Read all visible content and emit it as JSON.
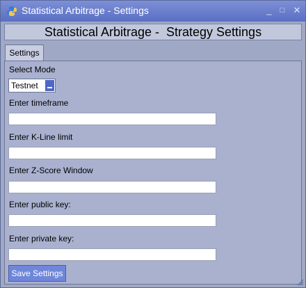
{
  "window": {
    "title": "Statistical Arbitrage - Settings",
    "minimize_glyph": "_",
    "maximize_glyph": "□",
    "close_glyph": "✕"
  },
  "header": {
    "title": "Statistical Arbitrage -  Strategy Settings"
  },
  "tabs": [
    {
      "label": "Settings",
      "selected": true
    }
  ],
  "form": {
    "mode": {
      "label": "Select Mode",
      "value": "Testnet"
    },
    "timeframe": {
      "label": "Enter timeframe",
      "value": ""
    },
    "kline_limit": {
      "label": "Enter K-Line limit",
      "value": ""
    },
    "zscore_window": {
      "label": "Enter Z-Score Window",
      "value": ""
    },
    "public_key": {
      "label": "Enter public key:",
      "value": ""
    },
    "private_key": {
      "label": "Enter private key:",
      "value": ""
    },
    "save_label": "Save Settings"
  },
  "colors": {
    "titlebar": "#6a7fd0",
    "window_bg": "#9fa8c4",
    "panel_bg": "#a9b1cf",
    "button": "#6f86da"
  },
  "icons": {
    "app": "python-icon"
  }
}
